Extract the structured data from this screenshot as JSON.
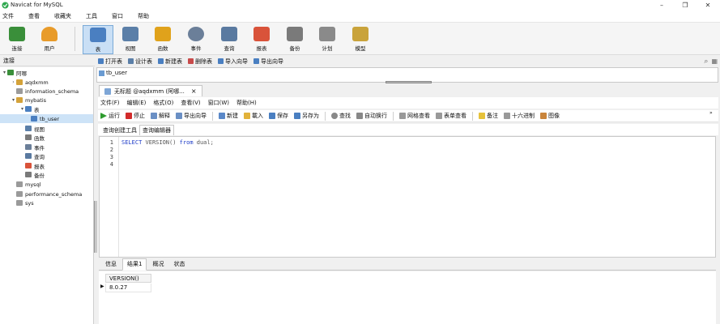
{
  "window": {
    "title": "Navicat for MySQL",
    "minimize": "–",
    "maximize": "❐",
    "close": "✕"
  },
  "menubar": [
    "文件",
    "查看",
    "收藏夹",
    "工具",
    "窗口",
    "帮助"
  ],
  "toolbar": {
    "items": [
      {
        "label": "连接",
        "icon": "connection-icon",
        "color": "#3a8f3a"
      },
      {
        "label": "用户",
        "icon": "user-icon",
        "color": "#e89b2a"
      },
      {
        "label": "表",
        "icon": "table-icon",
        "color": "#4a7fc1",
        "active": true
      },
      {
        "label": "视图",
        "icon": "view-icon",
        "color": "#5b7fa8"
      },
      {
        "label": "函数",
        "icon": "function-icon",
        "color": "#e0a21b"
      },
      {
        "label": "事件",
        "icon": "event-icon",
        "color": "#6b7f99"
      },
      {
        "label": "查询",
        "icon": "query-icon",
        "color": "#5a7aa0"
      },
      {
        "label": "报表",
        "icon": "report-icon",
        "color": "#d9533a"
      },
      {
        "label": "备份",
        "icon": "backup-icon",
        "color": "#7a7a7a"
      },
      {
        "label": "计划",
        "icon": "schedule-icon",
        "color": "#8a8a8a"
      },
      {
        "label": "模型",
        "icon": "model-icon",
        "color": "#c9a33b"
      }
    ]
  },
  "connection_header": "连接",
  "object_toolbar": [
    "打开表",
    "设计表",
    "新建表",
    "删除表",
    "导入向导",
    "导出向导"
  ],
  "tree": [
    {
      "label": "阿哪",
      "level": 0,
      "arrow": "▾",
      "icon_color": "#3a8f3a"
    },
    {
      "label": "aqdxmm",
      "level": 1,
      "arrow": "›",
      "icon_color": "#d4a23a"
    },
    {
      "label": "information_schema",
      "level": 1,
      "arrow": "",
      "icon_color": "#9a9a9a"
    },
    {
      "label": "mybatis",
      "level": 1,
      "arrow": "▾",
      "icon_color": "#d4a23a"
    },
    {
      "label": "表",
      "level": 2,
      "arrow": "▾",
      "icon_color": "#4a7fc1"
    },
    {
      "label": "tb_user",
      "level": 3,
      "arrow": "",
      "icon_color": "#4a7fc1",
      "selected": true
    },
    {
      "label": "视图",
      "level": 2,
      "arrow": "",
      "icon_color": "#5b7fa8"
    },
    {
      "label": "函数",
      "level": 2,
      "arrow": "",
      "icon_color": "#7a7a7a"
    },
    {
      "label": "事件",
      "level": 2,
      "arrow": "",
      "icon_color": "#6b7f99"
    },
    {
      "label": "查询",
      "level": 2,
      "arrow": "",
      "icon_color": "#5a7aa0"
    },
    {
      "label": "报表",
      "level": 2,
      "arrow": "",
      "icon_color": "#d9533a"
    },
    {
      "label": "备份",
      "level": 2,
      "arrow": "",
      "icon_color": "#7a7a7a"
    },
    {
      "label": "mysql",
      "level": 1,
      "arrow": "",
      "icon_color": "#9a9a9a"
    },
    {
      "label": "performance_schema",
      "level": 1,
      "arrow": "",
      "icon_color": "#9a9a9a"
    },
    {
      "label": "sys",
      "level": 1,
      "arrow": "",
      "icon_color": "#9a9a9a"
    }
  ],
  "object_list": {
    "item": "tb_user"
  },
  "doc_tab": {
    "label": "无标题 @aqdxmm (阿哪...",
    "close": "×"
  },
  "query_menu": [
    "文件(F)",
    "编辑(E)",
    "格式(O)",
    "查看(V)",
    "窗口(W)",
    "帮助(H)"
  ],
  "query_toolbar": [
    {
      "label": "运行",
      "color": "#2e9b2e"
    },
    {
      "label": "停止",
      "color": "#d22b2b"
    },
    {
      "label": "解释",
      "color": "#6a8fc4"
    },
    {
      "label": "导出向导",
      "color": "#6a8fc4"
    },
    {
      "label": "新建",
      "color": "#5a88c8",
      "sep_before": true
    },
    {
      "label": "載入",
      "color": "#e2b23a"
    },
    {
      "label": "保存",
      "color": "#4a7fc1"
    },
    {
      "label": "另存为",
      "color": "#4a7fc1"
    },
    {
      "label": "查找",
      "color": "#888",
      "sep_before": true
    },
    {
      "label": "自动换行",
      "color": "#888"
    },
    {
      "label": "网格查看",
      "color": "#999",
      "sep_before": true
    },
    {
      "label": "表单查看",
      "color": "#999"
    },
    {
      "label": "备注",
      "color": "#e6c23b",
      "sep_before": true
    },
    {
      "label": "十六进制",
      "color": "#999"
    },
    {
      "label": "图像",
      "color": "#c9843b"
    }
  ],
  "query_overflow": "»",
  "sub_tabs": [
    {
      "label": "查询创建工具",
      "active": false
    },
    {
      "label": "查询编辑器",
      "active": true
    }
  ],
  "editor": {
    "line_numbers": [
      "1",
      "2",
      "3",
      "4"
    ],
    "code_select": "SELECT",
    "code_fn": "VERSION()",
    "code_from": "from",
    "code_table": "dual;"
  },
  "result_tabs": [
    {
      "label": "信息",
      "active": false
    },
    {
      "label": "结果1",
      "active": true
    },
    {
      "label": "概况",
      "active": false
    },
    {
      "label": "状态",
      "active": false
    }
  ],
  "result": {
    "column": "VERSION()",
    "value": "8.0.27",
    "row_marker": "▶"
  }
}
